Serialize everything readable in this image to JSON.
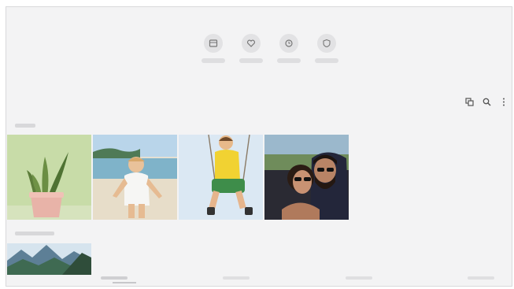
{
  "top_actions": [
    {
      "label": "",
      "icon": "album-icon"
    },
    {
      "label": "",
      "icon": "heart-icon"
    },
    {
      "label": "",
      "icon": "clock-icon"
    },
    {
      "label": "",
      "icon": "shield-icon"
    }
  ],
  "toolbar": {
    "icons": [
      "multi-window-icon",
      "search-icon",
      "more-options-icon"
    ]
  },
  "sections": [
    {
      "title": "",
      "items": [
        {
          "name": "plant"
        },
        {
          "name": "child-beach"
        },
        {
          "name": "child-swing"
        },
        {
          "name": "couple-selfie"
        }
      ]
    },
    {
      "title": "",
      "items": [
        {
          "name": "mountains"
        }
      ]
    }
  ],
  "bottom_tabs": [
    {
      "label": "",
      "active": true
    },
    {
      "label": "",
      "active": false
    },
    {
      "label": "",
      "active": false
    },
    {
      "label": "",
      "active": false
    }
  ],
  "colors": {
    "background": "#f3f3f4",
    "plant_bg": "#c8dca8",
    "sky": "#dbe8f3",
    "couple_bg": "#2a2a33"
  }
}
